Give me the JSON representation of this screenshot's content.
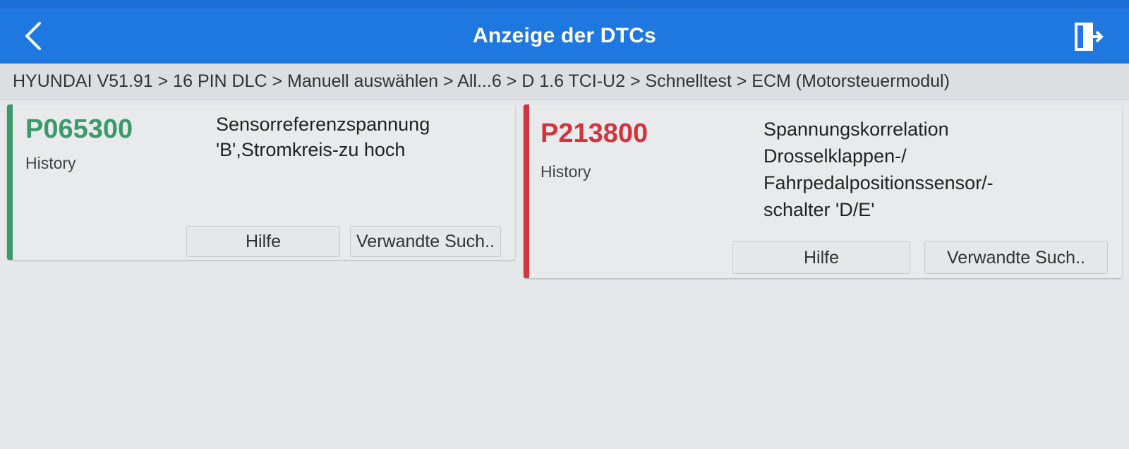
{
  "header": {
    "title": "Anzeige der DTCs",
    "accent": "#1f78e0"
  },
  "breadcrumb": "HYUNDAI V51.91 > 16 PIN DLC > Manuell auswählen > All...6 > D 1.6 TCI-U2 > Schnelltest > ECM (Motorsteuermodul)",
  "dtcs": [
    {
      "code": "P065300",
      "status": "History",
      "description_lines": [
        "Sensorreferenzspannung",
        "'B',Stromkreis-zu hoch"
      ],
      "color": "#3a9a6a",
      "help_label": "Hilfe",
      "related_label": "Verwandte Such.."
    },
    {
      "code": "P213800",
      "status": "History",
      "description_lines": [
        "Spannungskorrelation",
        "Drosselklappen-/",
        "Fahrpedalpositionssensor/-",
        "schalter 'D/E'"
      ],
      "color": "#d3353c",
      "help_label": "Hilfe",
      "related_label": "Verwandte Such.."
    }
  ],
  "icons": {
    "back": "back-arrow-icon",
    "exit": "exit-icon"
  }
}
